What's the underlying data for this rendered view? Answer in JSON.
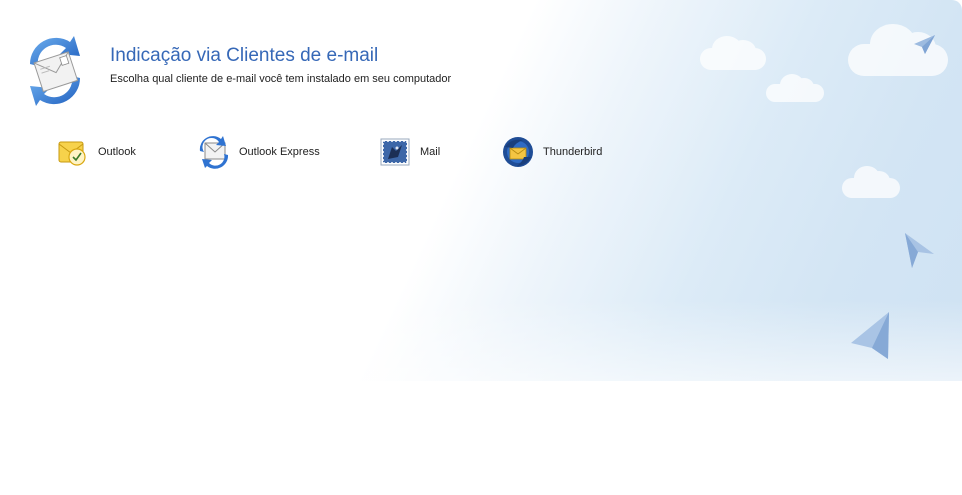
{
  "header": {
    "title": "Indicação via Clientes de e-mail",
    "subtitle": "Escolha qual cliente de e-mail você tem instalado em seu computador",
    "icon": "email-send-arrows-icon"
  },
  "clients": [
    {
      "label": "Outlook",
      "icon": "outlook-icon"
    },
    {
      "label": "Outlook Express",
      "icon": "outlook-express-icon"
    },
    {
      "label": "Mail",
      "icon": "apple-mail-icon"
    },
    {
      "label": "Thunderbird",
      "icon": "thunderbird-icon"
    }
  ],
  "decorations": {
    "clouds": "cloud-icon",
    "planes": "paper-plane-icon"
  },
  "colors": {
    "title": "#3668b7",
    "sky": "#d3e5f4"
  }
}
